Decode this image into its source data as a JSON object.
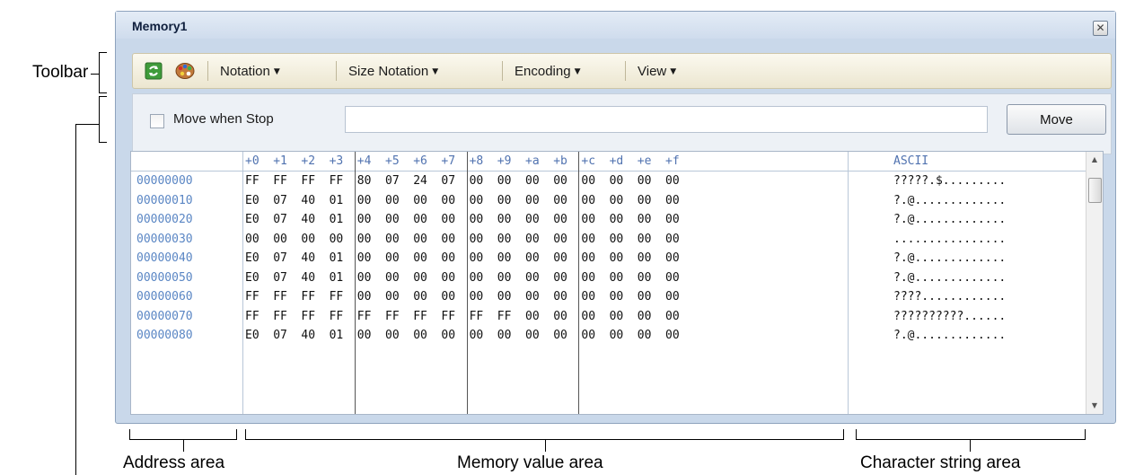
{
  "annotations": {
    "toolbar": "Toolbar",
    "address_area": "Address area",
    "memory_value_area": "Memory value area",
    "character_string_area": "Character string area"
  },
  "window": {
    "title": "Memory1",
    "close_glyph": "✕"
  },
  "toolbar": {
    "notation": "Notation",
    "size_notation": "Size Notation",
    "encoding": "Encoding",
    "view": "View",
    "dropdown_arrow": "▼"
  },
  "move_bar": {
    "checkbox_label": "Move when Stop",
    "address_value": "",
    "move_button": "Move"
  },
  "grid": {
    "offsets": [
      "+0",
      "+1",
      "+2",
      "+3",
      "+4",
      "+5",
      "+6",
      "+7",
      "+8",
      "+9",
      "+a",
      "+b",
      "+c",
      "+d",
      "+e",
      "+f"
    ],
    "ascii_header": "ASCII",
    "rows": [
      {
        "address": "00000000",
        "bytes": [
          "FF",
          "FF",
          "FF",
          "FF",
          "80",
          "07",
          "24",
          "07",
          "00",
          "00",
          "00",
          "00",
          "00",
          "00",
          "00",
          "00"
        ],
        "ascii": "?????.$........."
      },
      {
        "address": "00000010",
        "bytes": [
          "E0",
          "07",
          "40",
          "01",
          "00",
          "00",
          "00",
          "00",
          "00",
          "00",
          "00",
          "00",
          "00",
          "00",
          "00",
          "00"
        ],
        "ascii": "?.@............."
      },
      {
        "address": "00000020",
        "bytes": [
          "E0",
          "07",
          "40",
          "01",
          "00",
          "00",
          "00",
          "00",
          "00",
          "00",
          "00",
          "00",
          "00",
          "00",
          "00",
          "00"
        ],
        "ascii": "?.@............."
      },
      {
        "address": "00000030",
        "bytes": [
          "00",
          "00",
          "00",
          "00",
          "00",
          "00",
          "00",
          "00",
          "00",
          "00",
          "00",
          "00",
          "00",
          "00",
          "00",
          "00"
        ],
        "ascii": "................"
      },
      {
        "address": "00000040",
        "bytes": [
          "E0",
          "07",
          "40",
          "01",
          "00",
          "00",
          "00",
          "00",
          "00",
          "00",
          "00",
          "00",
          "00",
          "00",
          "00",
          "00"
        ],
        "ascii": "?.@............."
      },
      {
        "address": "00000050",
        "bytes": [
          "E0",
          "07",
          "40",
          "01",
          "00",
          "00",
          "00",
          "00",
          "00",
          "00",
          "00",
          "00",
          "00",
          "00",
          "00",
          "00"
        ],
        "ascii": "?.@............."
      },
      {
        "address": "00000060",
        "bytes": [
          "FF",
          "FF",
          "FF",
          "FF",
          "00",
          "00",
          "00",
          "00",
          "00",
          "00",
          "00",
          "00",
          "00",
          "00",
          "00",
          "00"
        ],
        "ascii": "????............"
      },
      {
        "address": "00000070",
        "bytes": [
          "FF",
          "FF",
          "FF",
          "FF",
          "FF",
          "FF",
          "FF",
          "FF",
          "FF",
          "FF",
          "00",
          "00",
          "00",
          "00",
          "00",
          "00"
        ],
        "ascii": "??????????......"
      },
      {
        "address": "00000080",
        "bytes": [
          "E0",
          "07",
          "40",
          "01",
          "00",
          "00",
          "00",
          "00",
          "00",
          "00",
          "00",
          "00",
          "00",
          "00",
          "00",
          "00"
        ],
        "ascii": "?.@............."
      }
    ]
  },
  "scrollbar": {
    "up_glyph": "▲",
    "down_glyph": "▼"
  }
}
